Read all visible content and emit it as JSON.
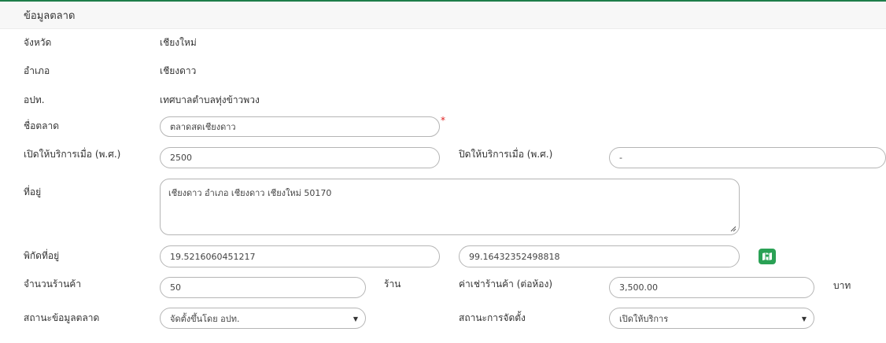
{
  "section": {
    "title": "ข้อมูลตลาด"
  },
  "province": {
    "label": "จังหวัด",
    "value": "เชียงใหม่"
  },
  "district": {
    "label": "อำเภอ",
    "value": "เชียงดาว"
  },
  "local_admin": {
    "label": "อปท.",
    "value": "เทศบาลตำบลทุ่งข้าวพวง"
  },
  "market_name": {
    "label": "ชื่อตลาด",
    "value": "ตลาดสดเชียงดาว",
    "required_mark": "*"
  },
  "open_year": {
    "label": "เปิดให้บริการเมื่อ (พ.ศ.)",
    "value": "2500"
  },
  "close_year": {
    "label": "ปิดให้บริการเมื่อ (พ.ศ.)",
    "value": "-"
  },
  "address": {
    "label": "ที่อยู่",
    "value": "เชียงดาว อำเภอ เชียงดาว เชียงใหม่ 50170"
  },
  "coordinates": {
    "label": "พิกัดที่อยู่",
    "lat": "19.5216060451217",
    "lng": "99.16432352498818",
    "map_icon": "map-icon"
  },
  "shop_count": {
    "label": "จำนวนร้านค้า",
    "value": "50",
    "unit": "ร้าน"
  },
  "rent": {
    "label": "ค่าเช่าร้านค้า (ต่อห้อง)",
    "value": "3,500.00",
    "unit": "บาท"
  },
  "market_status": {
    "label": "สถานะข้อมูลตลาด",
    "selected": "จัดตั้งขึ้นโดย อปท."
  },
  "setup_status": {
    "label": "สถานะการจัดตั้ง",
    "selected": "เปิดให้บริการ"
  },
  "colors": {
    "accent": "#1e7e4a",
    "map_button": "#2aa155",
    "required": "#e02020"
  }
}
